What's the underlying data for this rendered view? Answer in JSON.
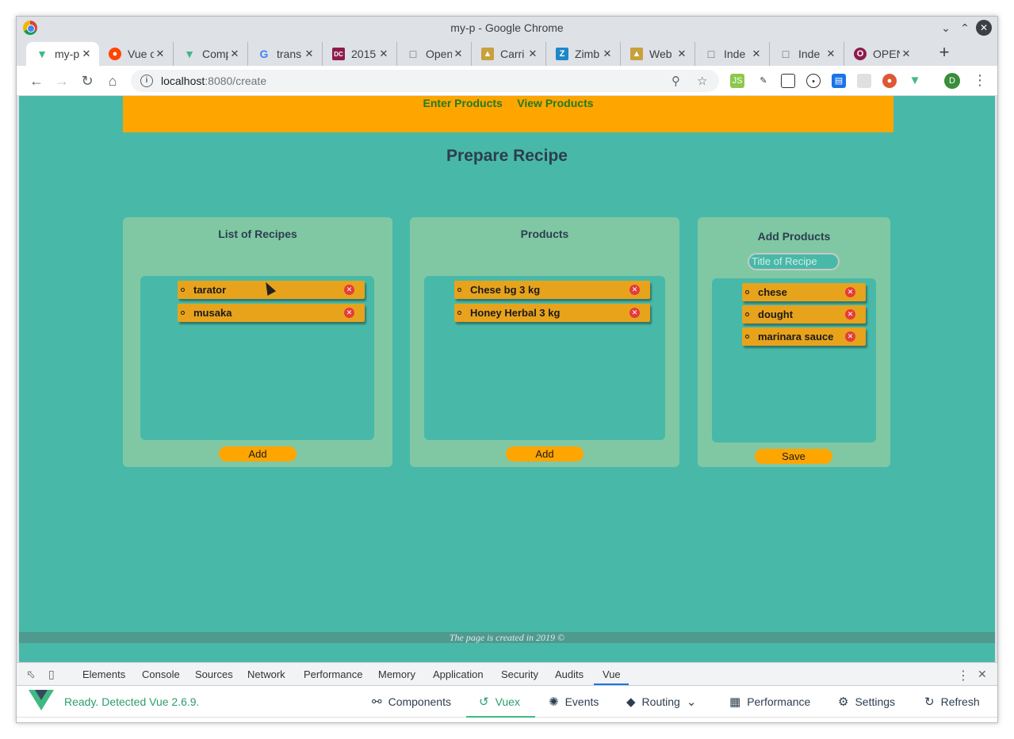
{
  "window": {
    "title": "my-p - Google Chrome"
  },
  "tabs": [
    {
      "label": "my-p",
      "active": true,
      "favicon": "vue-icon",
      "color": "#41b883"
    },
    {
      "label": "Vue c",
      "favicon": "reddit-icon",
      "color": "#ff4500"
    },
    {
      "label": "Comp",
      "favicon": "vue-icon",
      "color": "#41b883"
    },
    {
      "label": "trans",
      "favicon": "google-icon",
      "color": "#4285f4"
    },
    {
      "label": "2015",
      "favicon": "dc-icon",
      "color": "#8e1c4a"
    },
    {
      "label": "Open",
      "favicon": "document-icon",
      "color": "#9aa0a6"
    },
    {
      "label": "Carri",
      "favicon": "chart-icon",
      "color": "#c8a03c"
    },
    {
      "label": "Zimb",
      "favicon": "zimbra-icon",
      "color": "#1e88c9"
    },
    {
      "label": "Web",
      "favicon": "chart-icon",
      "color": "#c8a03c"
    },
    {
      "label": "Inde",
      "favicon": "document-icon",
      "color": "#9aa0a6"
    },
    {
      "label": "Inde",
      "favicon": "document-icon",
      "color": "#9aa0a6"
    },
    {
      "label": "OPEN",
      "favicon": "opera-icon",
      "color": "#8e1c4a"
    }
  ],
  "address": {
    "host": "localhost",
    "path": ":8080/create"
  },
  "profile_initial": "D",
  "nav": {
    "enter_products": "Enter Products",
    "view_products": "View Products"
  },
  "page_title": "Prepare Recipe",
  "recipes_panel": {
    "title": "List of Recipes",
    "items": [
      "tarator",
      "musaka"
    ],
    "button": "Add"
  },
  "products_panel": {
    "title": "Products",
    "items": [
      "Chese bg 3 kg",
      "Honey Herbal 3 kg"
    ],
    "button": "Add"
  },
  "add_products_panel": {
    "title": "Add Products",
    "input_placeholder": "Title of Recipe",
    "items": [
      "chese",
      "dought",
      "marinara sauce"
    ],
    "button": "Save"
  },
  "footer": "The page is created in 2019 ©",
  "devtools": {
    "tabs": [
      "Elements",
      "Console",
      "Sources",
      "Network",
      "Performance",
      "Memory",
      "Application",
      "Security",
      "Audits",
      "Vue"
    ],
    "active_tab": "Vue",
    "vue_status": "Ready. Detected Vue 2.6.9.",
    "vue_nav": [
      "Components",
      "Vuex",
      "Events",
      "Routing",
      "Performance",
      "Settings",
      "Refresh"
    ],
    "vue_active": "Vuex"
  },
  "colors": {
    "page_bg": "#48b9a8",
    "navbar": "#ffa500",
    "panel": "#80c8a3",
    "item": "#e8a31c",
    "nav_link": "#227a22"
  }
}
